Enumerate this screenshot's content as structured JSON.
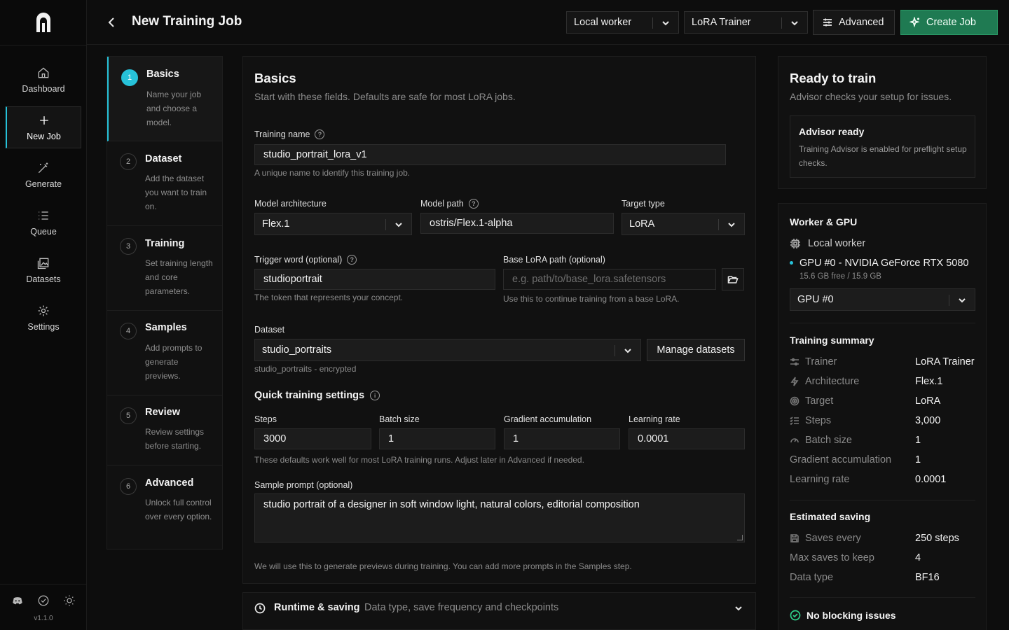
{
  "nav": {
    "items": [
      {
        "label": "Dashboard",
        "icon": "home-icon"
      },
      {
        "label": "New Job",
        "icon": "plus-icon"
      },
      {
        "label": "Generate",
        "icon": "magic-wand-icon"
      },
      {
        "label": "Queue",
        "icon": "list-icon"
      },
      {
        "label": "Datasets",
        "icon": "images-icon"
      },
      {
        "label": "Settings",
        "icon": "gear-icon"
      }
    ],
    "active": "New Job",
    "version": "v1.1.0",
    "accent": "#27c2d9"
  },
  "header": {
    "title": "New Training Job",
    "worker_select": "Local worker",
    "trainer_select": "LoRA Trainer",
    "advanced_label": "Advanced",
    "create_label": "Create Job",
    "create_color": "#1f7a52"
  },
  "steps": [
    {
      "num": "1",
      "title": "Basics",
      "desc": "Name your job and choose a model."
    },
    {
      "num": "2",
      "title": "Dataset",
      "desc": "Add the dataset you want to train on."
    },
    {
      "num": "3",
      "title": "Training",
      "desc": "Set training length and core parameters."
    },
    {
      "num": "4",
      "title": "Samples",
      "desc": "Add prompts to generate previews."
    },
    {
      "num": "5",
      "title": "Review",
      "desc": "Review settings before starting."
    },
    {
      "num": "6",
      "title": "Advanced",
      "desc": "Unlock full control over every option."
    }
  ],
  "form": {
    "title": "Basics",
    "subtitle": "Start with these fields. Defaults are safe for most LoRA jobs.",
    "training_name": {
      "label": "Training name",
      "value": "studio_portrait_lora_v1",
      "hint": "A unique name to identify this training job."
    },
    "model_arch": {
      "label": "Model architecture",
      "value": "Flex.1"
    },
    "model_path": {
      "label": "Model path",
      "value": "ostris/Flex.1-alpha"
    },
    "target_type": {
      "label": "Target type",
      "value": "LoRA"
    },
    "trigger_word": {
      "label": "Trigger word (optional)",
      "value": "studioportrait",
      "hint": "The token that represents your concept."
    },
    "base_lora": {
      "label": "Base LoRA path (optional)",
      "placeholder": "e.g. path/to/base_lora.safetensors",
      "hint": "Use this to continue training from a base LoRA."
    },
    "dataset": {
      "label": "Dataset",
      "value": "studio_portraits",
      "hint": "studio_portraits - encrypted",
      "manage_label": "Manage datasets"
    },
    "quick_title": "Quick training settings",
    "steps": {
      "label": "Steps",
      "value": "3000"
    },
    "batch_size": {
      "label": "Batch size",
      "value": "1"
    },
    "grad_accum": {
      "label": "Gradient accumulation",
      "value": "1"
    },
    "learning_rate": {
      "label": "Learning rate",
      "value": "0.0001"
    },
    "quick_hint": "These defaults work well for most LoRA training runs. Adjust later in Advanced if needed.",
    "sample_prompt": {
      "label": "Sample prompt (optional)",
      "value": "studio portrait of a designer in soft window light, natural colors, editorial composition",
      "hint": "We will use this to generate previews during training. You can add more prompts in the Samples step."
    }
  },
  "runtime_section": {
    "title": "Runtime & saving",
    "desc": "Data type, save frequency and checkpoints"
  },
  "right": {
    "ready_title": "Ready to train",
    "ready_sub": "Advisor checks your setup for issues.",
    "advisor_title": "Advisor ready",
    "advisor_desc": "Training Advisor is enabled for preflight setup checks.",
    "worker_title": "Worker & GPU",
    "worker_name": "Local worker",
    "gpu_name": "GPU #0 - NVIDIA GeForce RTX 5080",
    "gpu_mem": "15.6 GB free / 15.9 GB",
    "gpu_select": "GPU #0",
    "summary_title": "Training summary",
    "summary": [
      {
        "key": "Trainer",
        "value": "LoRA Trainer",
        "icon": "sliders-icon"
      },
      {
        "key": "Architecture",
        "value": "Flex.1",
        "icon": "bolt-icon"
      },
      {
        "key": "Target",
        "value": "LoRA",
        "icon": "target-icon"
      },
      {
        "key": "Steps",
        "value": "3,000",
        "icon": "list-check-icon"
      },
      {
        "key": "Batch size",
        "value": "1",
        "icon": "gauge-icon"
      },
      {
        "key": "Gradient accumulation",
        "value": "1",
        "icon": ""
      },
      {
        "key": "Learning rate",
        "value": "0.0001",
        "icon": ""
      }
    ],
    "saving_title": "Estimated saving",
    "saving": [
      {
        "key": "Saves every",
        "value": "250 steps",
        "icon": "save-icon"
      },
      {
        "key": "Max saves to keep",
        "value": "4",
        "icon": ""
      },
      {
        "key": "Data type",
        "value": "BF16",
        "icon": ""
      }
    ],
    "status": "No blocking issues",
    "status_color": "#2fd08a"
  }
}
